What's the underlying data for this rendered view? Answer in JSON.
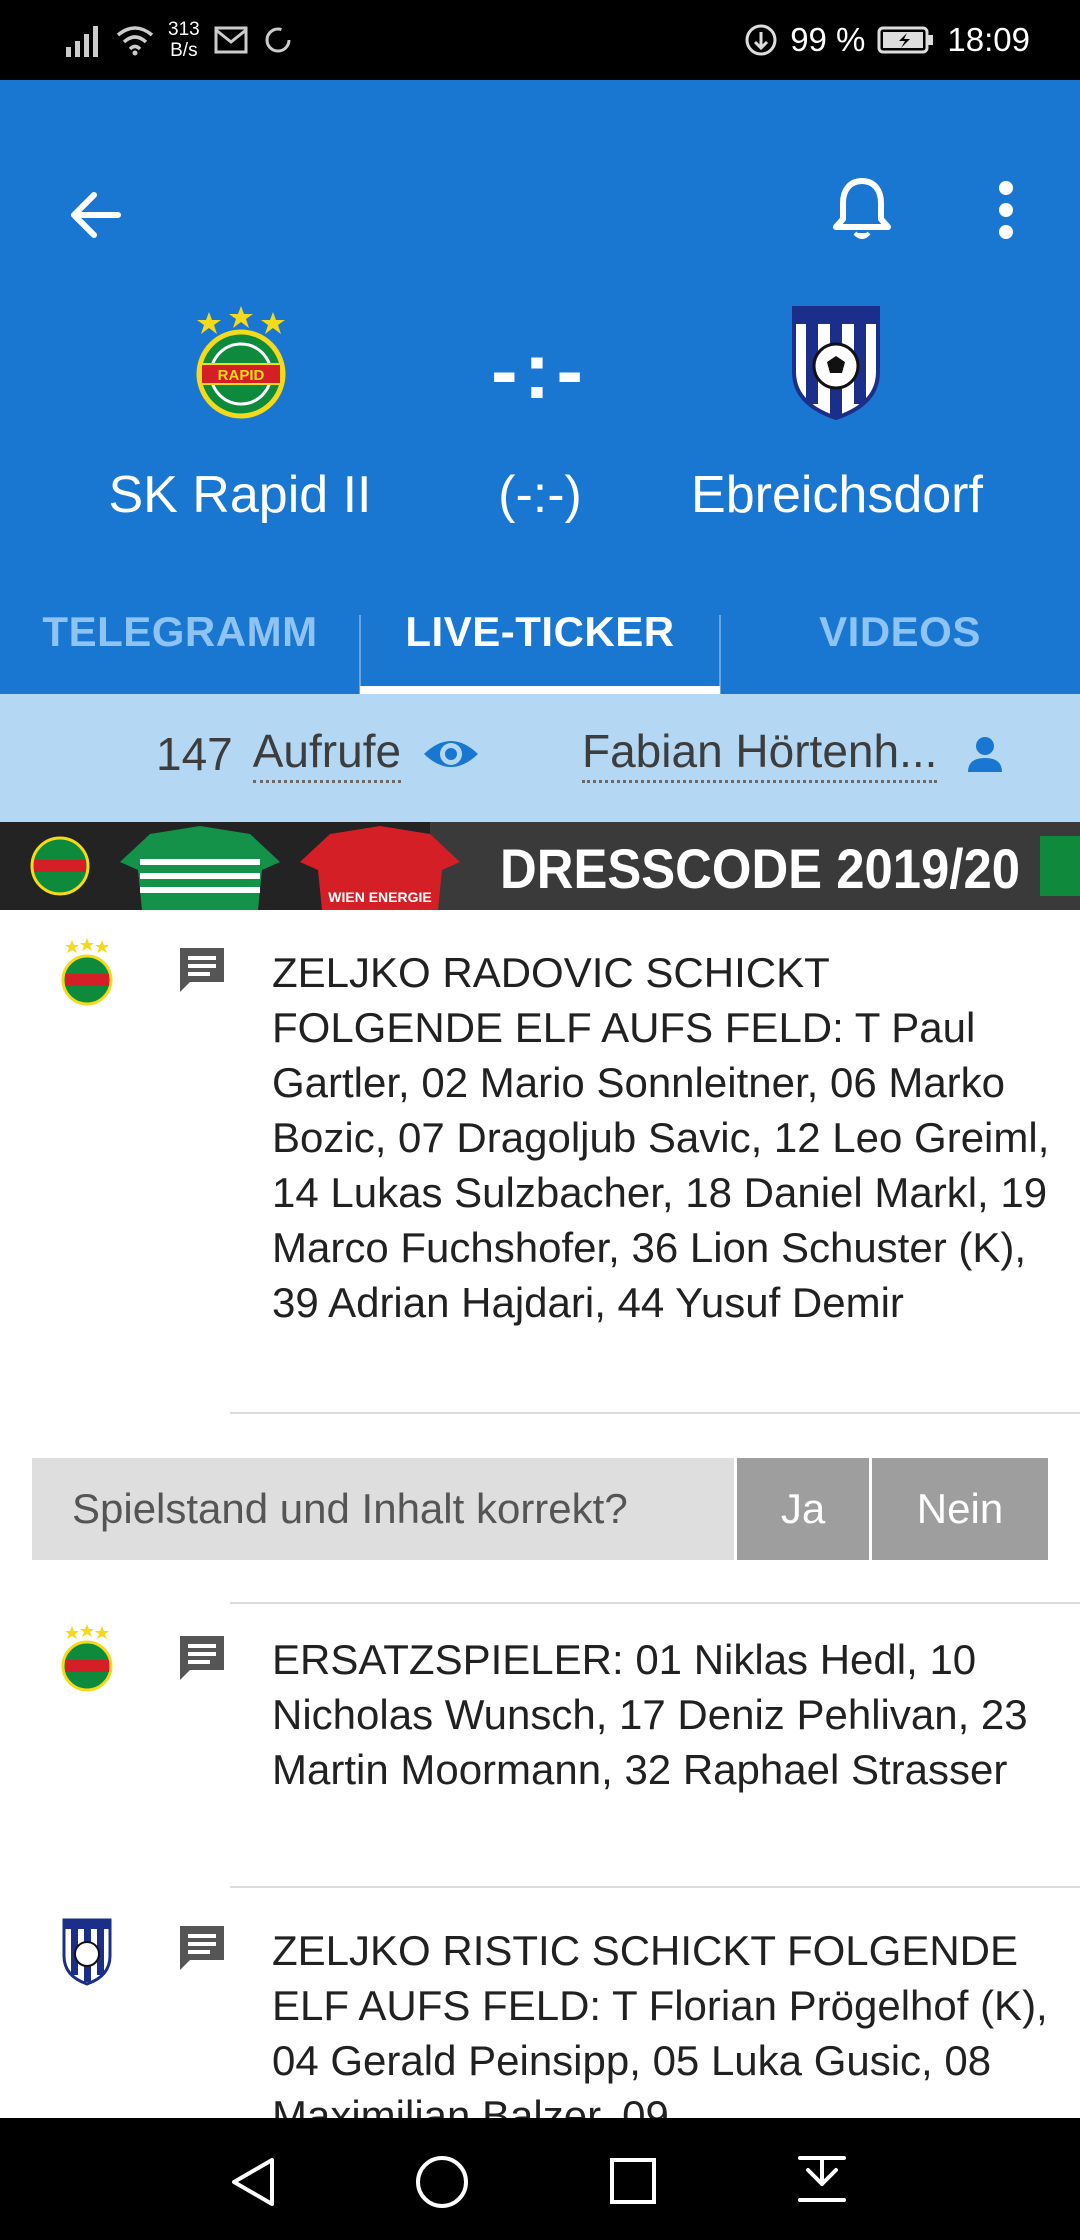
{
  "status_bar": {
    "net_speed_value": "313",
    "net_speed_unit": "B/s",
    "battery": "99 %",
    "time": "18:09"
  },
  "match": {
    "home_team": "SK Rapid II",
    "away_team": "Ebreichsdorf",
    "score": "-:-",
    "half_time_score": "(-:-)"
  },
  "tabs": [
    {
      "label": "TELEGRAMM"
    },
    {
      "label": "LIVE-TICKER"
    },
    {
      "label": "VIDEOS"
    }
  ],
  "info": {
    "views": "147",
    "views_label": "Aufrufe",
    "author": "Fabian Hörtenh..."
  },
  "banner": {
    "text": "DRESSCODE 2019/20",
    "jersey_text": "WIEN ENERGIE",
    "brand": "RAPID"
  },
  "feed": [
    {
      "team": "home",
      "text": "ZELJKO RADOVIC SCHICKT FOLGENDE ELF AUFS FELD: T Paul Gartler, 02 Mario Sonnleitner, 06 Marko Bozic, 07 Dragoljub Savic, 12 Leo Greiml, 14 Lukas Sulzbacher, 18 Daniel Markl, 19 Marco Fuchshofer, 36 Lion Schuster (K), 39 Adrian Hajdari, 44 Yusuf Demir"
    },
    {
      "team": "home",
      "text": "ERSATZSPIELER: 01 Niklas Hedl, 10 Nicholas Wunsch, 17 Deniz Pehlivan, 23 Martin Moormann, 32 Raphael Strasser"
    },
    {
      "team": "away",
      "text": "ZELJKO RISTIC SCHICKT FOLGENDE ELF AUFS FELD: T Florian Prögelhof (K), 04 Gerald Peinsipp, 05 Luka Gusic, 08 Maximilian Balzer, 09"
    }
  ],
  "feedback": {
    "question": "Spielstand und Inhalt korrekt?",
    "yes": "Ja",
    "no": "Nein"
  },
  "colors": {
    "primary": "#1a77d1",
    "info_bar": "#b4d8f4",
    "tab_inactive": "#8ec3f3"
  },
  "icons": [
    "back-arrow-icon",
    "bell-icon",
    "more-vert-icon",
    "eye-icon",
    "person-icon",
    "comment-icon"
  ]
}
